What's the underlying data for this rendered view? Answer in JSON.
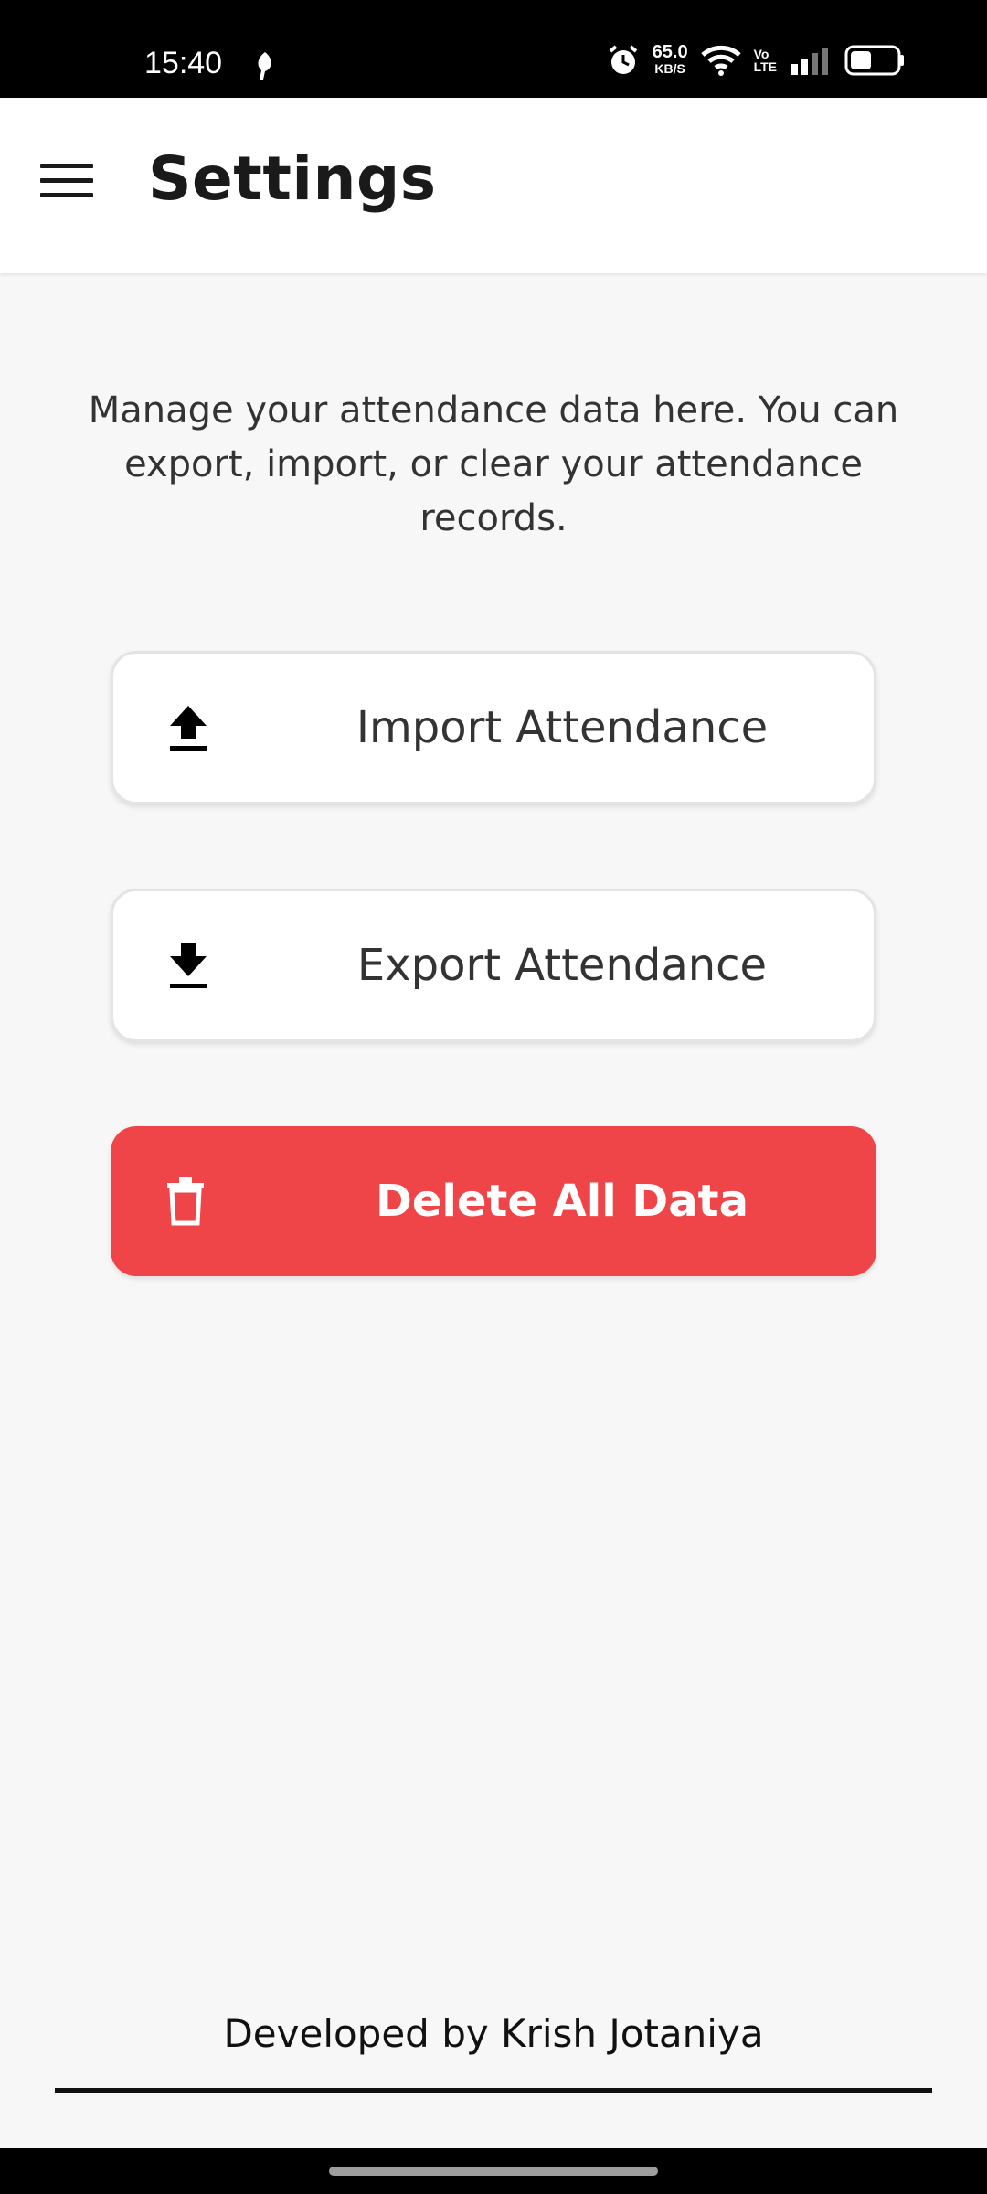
{
  "status_bar": {
    "time": "15:40",
    "speed_value": "65.0",
    "speed_unit": "KB/S",
    "volte_top": "Vo",
    "volte_bottom": "LTE",
    "icons": [
      "leaf-icon",
      "alarm-icon",
      "wifi-icon",
      "signal-icon",
      "battery-icon"
    ]
  },
  "app_bar": {
    "title": "Settings",
    "menu_icon": "hamburger-menu-icon"
  },
  "main": {
    "description": "Manage your attendance data here. You can export, import, or clear your attendance records.",
    "buttons": [
      {
        "label": "Import Attendance",
        "icon": "upload-icon"
      },
      {
        "label": "Export Attendance",
        "icon": "download-icon"
      },
      {
        "label": "Delete All Data",
        "icon": "trash-icon",
        "color": "#ef4549"
      }
    ]
  },
  "footer": {
    "credit": "Developed by Krish Jotaniya"
  }
}
